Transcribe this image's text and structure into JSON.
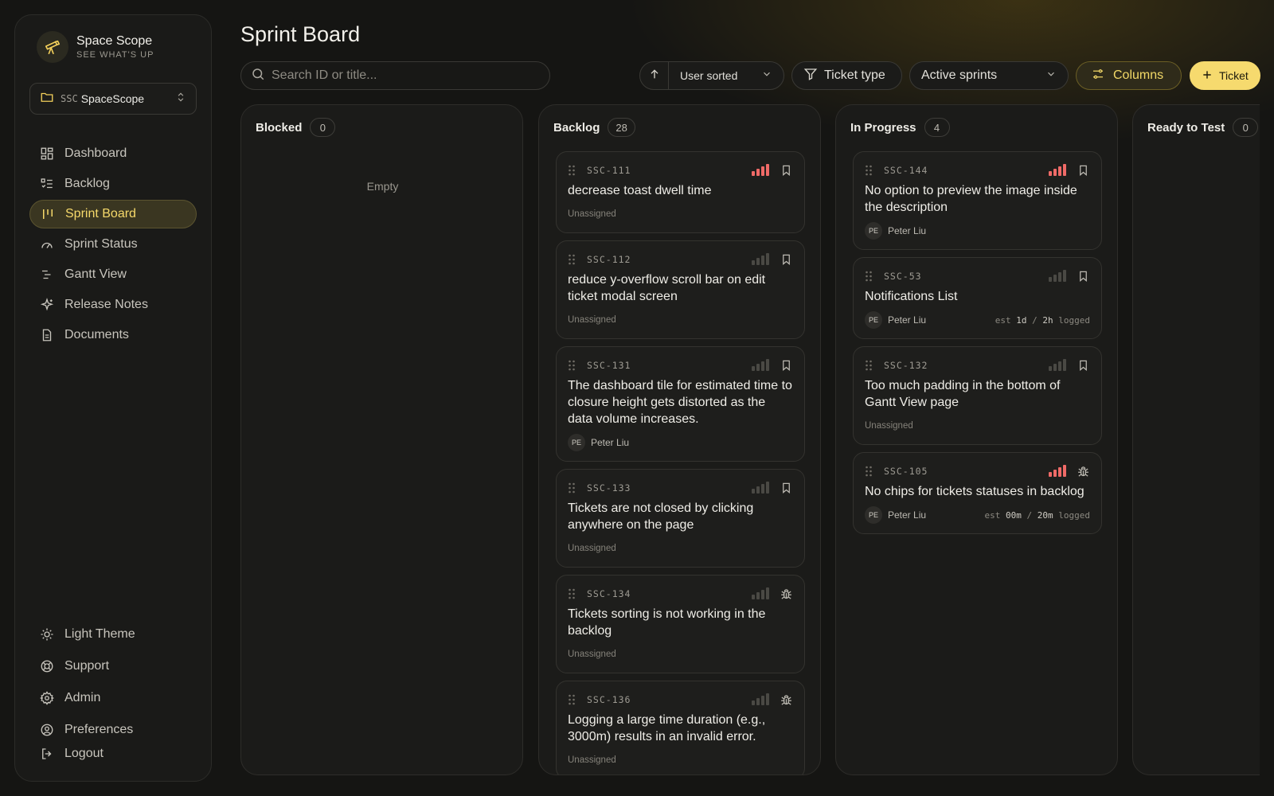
{
  "brand": {
    "name": "Space Scope",
    "tagline": "SEE WHAT'S UP"
  },
  "project": {
    "key": "SSC",
    "name": "SpaceScope"
  },
  "nav": [
    {
      "label": "Dashboard",
      "icon": "dashboard-icon",
      "active": false
    },
    {
      "label": "Backlog",
      "icon": "list-icon",
      "active": false
    },
    {
      "label": "Sprint Board",
      "icon": "board-icon",
      "active": true
    },
    {
      "label": "Sprint Status",
      "icon": "gauge-icon",
      "active": false
    },
    {
      "label": "Gantt View",
      "icon": "gantt-icon",
      "active": false
    },
    {
      "label": "Release Notes",
      "icon": "sparkles-icon",
      "active": false
    },
    {
      "label": "Documents",
      "icon": "document-icon",
      "active": false
    }
  ],
  "nav_bottom": [
    {
      "label": "Light Theme",
      "icon": "sun-icon"
    },
    {
      "label": "Support",
      "icon": "lifebuoy-icon"
    },
    {
      "label": "Admin",
      "icon": "gear-icon"
    },
    {
      "label": "Preferences",
      "icon": "user-circle-icon"
    }
  ],
  "logout_label": "Logout",
  "page_title": "Sprint Board",
  "search_placeholder": "Search ID or title...",
  "toolbar": {
    "sort_label": "User sorted",
    "ticket_type_label": "Ticket type",
    "sprint_filter": "Active sprints",
    "columns_label": "Columns",
    "new_ticket_label": "Ticket"
  },
  "colors": {
    "accent": "#f6da6e",
    "priority_high": "#ef6a67",
    "priority_medium": "#f0a437",
    "background": "#151513"
  },
  "columns": [
    {
      "title": "Blocked",
      "count": "0",
      "empty_label": "Empty",
      "cards": []
    },
    {
      "title": "Backlog",
      "count": "28",
      "cards": [
        {
          "id": "SSC-111",
          "title": "decrease toast dwell time",
          "priority": "high",
          "level": 4,
          "kind": "story",
          "assignee": "Unassigned",
          "initials": ""
        },
        {
          "id": "SSC-112",
          "title": "reduce y-overflow scroll bar on edit ticket modal screen",
          "priority": "medium",
          "level": 2,
          "kind": "story",
          "assignee": "Unassigned",
          "initials": ""
        },
        {
          "id": "SSC-131",
          "title": "The dashboard tile for estimated time to closure height gets distorted as the data volume increases.",
          "priority": "medium",
          "level": 3,
          "kind": "story",
          "assignee": "Peter Liu",
          "initials": "PE"
        },
        {
          "id": "SSC-133",
          "title": "Tickets are not closed by clicking anywhere on the page",
          "priority": "medium",
          "level": 2,
          "kind": "story",
          "assignee": "Unassigned",
          "initials": ""
        },
        {
          "id": "SSC-134",
          "title": "Tickets sorting is not working in the backlog",
          "priority": "medium",
          "level": 2,
          "kind": "bug",
          "assignee": "Unassigned",
          "initials": ""
        },
        {
          "id": "SSC-136",
          "title": "Logging a large time duration (e.g., 3000m) results in an invalid error.",
          "priority": "medium",
          "level": 2,
          "kind": "bug",
          "assignee": "Unassigned",
          "initials": ""
        }
      ]
    },
    {
      "title": "In Progress",
      "count": "4",
      "cards": [
        {
          "id": "SSC-144",
          "title": "No option to preview the image inside the description",
          "priority": "high",
          "level": 4,
          "kind": "story",
          "assignee": "Peter Liu",
          "initials": "PE"
        },
        {
          "id": "SSC-53",
          "title": "Notifications List",
          "priority": "medium",
          "level": 2,
          "kind": "story",
          "assignee": "Peter Liu",
          "initials": "PE",
          "est": "1d",
          "logged": "2h"
        },
        {
          "id": "SSC-132",
          "title": "Too much padding in the bottom of Gantt View page",
          "priority": "medium",
          "level": 2,
          "kind": "story",
          "assignee": "Unassigned",
          "initials": ""
        },
        {
          "id": "SSC-105",
          "title": "No chips for tickets statuses in backlog",
          "priority": "high",
          "level": 4,
          "kind": "bug",
          "assignee": "Peter Liu",
          "initials": "PE",
          "est": "00m",
          "logged": "20m"
        }
      ]
    },
    {
      "title": "Ready to Test",
      "count": "0",
      "cards": []
    }
  ],
  "labels": {
    "est_prefix": "est",
    "logged_suffix": "logged",
    "separator": "/"
  }
}
